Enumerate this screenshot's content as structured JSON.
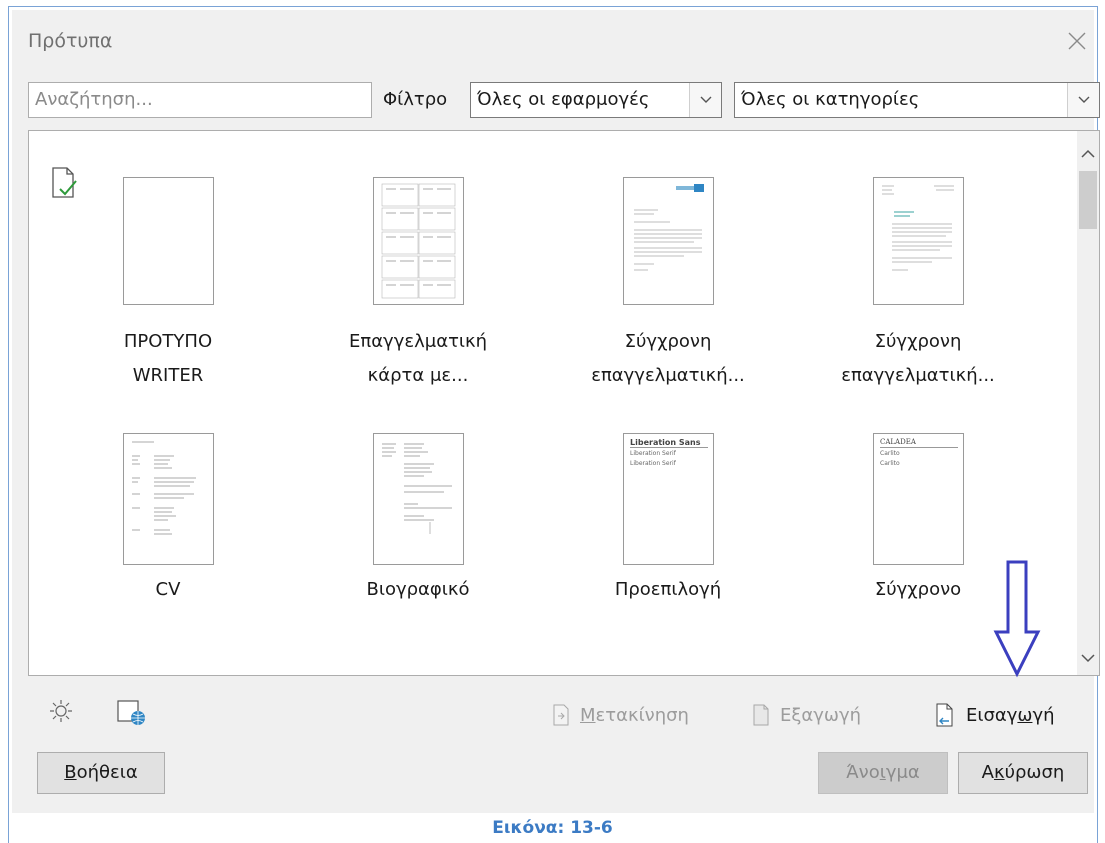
{
  "dialog": {
    "title": "Πρότυπα",
    "search_placeholder": "Αναζήτηση...",
    "filter_label": "Φίλτρο",
    "filter_apps_value": "Όλες οι εφαρμογές",
    "filter_category_value": "Όλες οι κατηγορίες"
  },
  "templates": [
    {
      "line1": "ΠΡΟΤΥΠΟ",
      "line2": "WRITER"
    },
    {
      "line1": "Επαγγελματική",
      "line2": "κάρτα με..."
    },
    {
      "line1": "Σύγχρονη",
      "line2": "επαγγελματική..."
    },
    {
      "line1": "Σύγχρονη",
      "line2": "επαγγελματική..."
    },
    {
      "line1": "CV",
      "line2": ""
    },
    {
      "line1": "Βιογραφικό",
      "line2": ""
    },
    {
      "line1": "Προεπιλογή",
      "line2": ""
    },
    {
      "line1": "Σύγχρονο",
      "line2": ""
    }
  ],
  "thumb_text": {
    "t7": "Liberation Sans",
    "t7_sub1": "Liberation Serif",
    "t7_sub2": "Liberation Serif",
    "t8": "CALADEA",
    "t8_sub1": "Carlito",
    "t8_sub2": "Carlito"
  },
  "actions": {
    "move_prefix": "",
    "move_ul": "Μ",
    "move_rest": "ετακίνηση",
    "export_label": "Εξαγωγή",
    "import_a": "Εισαγ",
    "import_ul": "ω",
    "import_b": "γή"
  },
  "buttons": {
    "help_ul": "Β",
    "help_rest": "οήθεια",
    "open_a": "Άνο",
    "open_ul": "ι",
    "open_b": "γμα",
    "cancel_a": "Α",
    "cancel_ul": "κ",
    "cancel_b": "ύρωση"
  },
  "caption": "Εικόνα: 13-6",
  "colors": {
    "frame": "#7aa3d6",
    "caption": "#3c7bc4",
    "annotation_arrow": "#3b3fbf"
  },
  "icons": [
    "close-icon",
    "chevron-down-icon",
    "default-template-check-icon",
    "settings-icon",
    "online-repository-icon",
    "move-icon",
    "export-icon",
    "import-icon"
  ]
}
